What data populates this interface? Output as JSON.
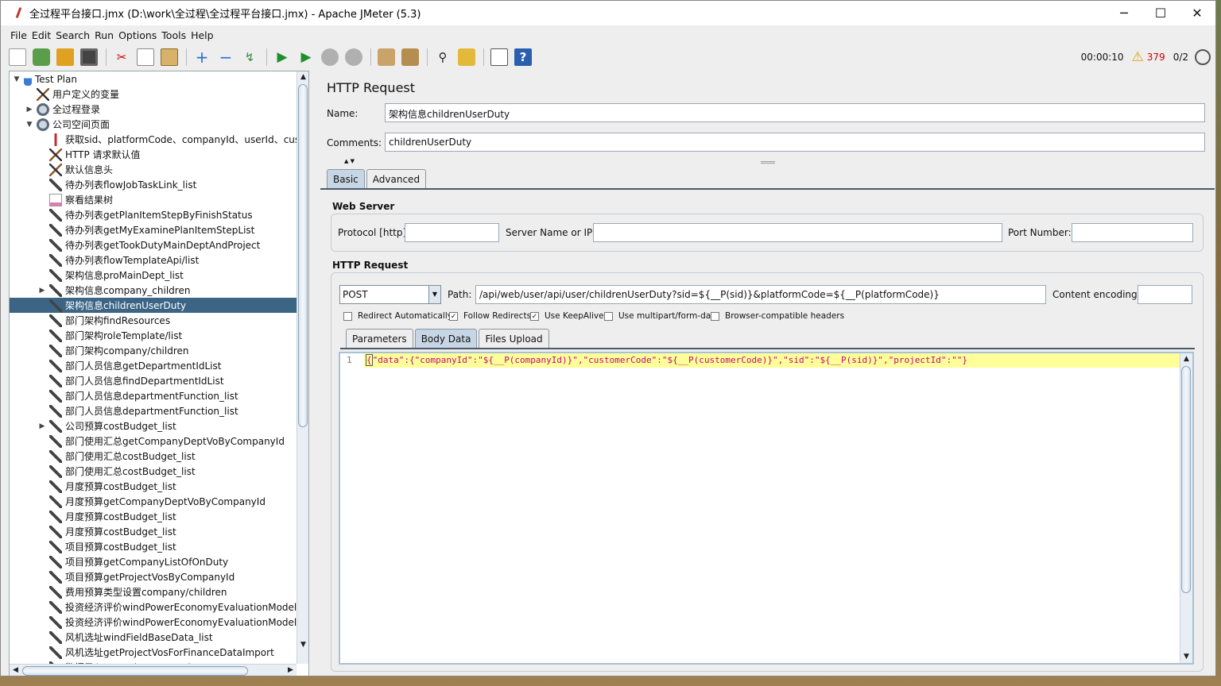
{
  "window": {
    "title": "全过程平台接口.jmx (D:\\work\\全过程\\全过程平台接口.jmx) - Apache JMeter (5.3)",
    "minimize": "─",
    "maximize": "☐",
    "close": "✕"
  },
  "menu": [
    "File",
    "Edit",
    "Search",
    "Run",
    "Options",
    "Tools",
    "Help"
  ],
  "toolbar": {
    "elapsed": "00:00:10",
    "warning_count": "379",
    "threads": "0/2"
  },
  "tree": {
    "items": [
      {
        "label": "Test Plan",
        "icon": "test-plan-icon",
        "level": 0,
        "toggle": "expanded"
      },
      {
        "label": "用户定义的变量",
        "icon": "wrench-icon",
        "level": 1
      },
      {
        "label": "全过程登录",
        "icon": "gear-icon",
        "level": 1,
        "toggle": "collapsed"
      },
      {
        "label": "公司空间页面",
        "icon": "gear-icon",
        "level": 1,
        "toggle": "expanded"
      },
      {
        "label": "获取sid、platformCode、companyId、userId、custo",
        "icon": "redirect-icon",
        "level": 2
      },
      {
        "label": "HTTP 请求默认值",
        "icon": "wrench-icon",
        "level": 2
      },
      {
        "label": "默认信息头",
        "icon": "wrench-icon",
        "level": 2
      },
      {
        "label": "待办列表flowJobTaskLink_list",
        "icon": "pipette-icon",
        "level": 2
      },
      {
        "label": "察看结果树",
        "icon": "graph-icon",
        "level": 2
      },
      {
        "label": "待办列表getPlanItemStepByFinishStatus",
        "icon": "pipette-icon",
        "level": 2
      },
      {
        "label": "待办列表getMyExaminePlanItemStepList",
        "icon": "pipette-icon",
        "level": 2
      },
      {
        "label": "待办列表getTookDutyMainDeptAndProject",
        "icon": "pipette-icon",
        "level": 2
      },
      {
        "label": "待办列表flowTemplateApi/list",
        "icon": "pipette-icon",
        "level": 2
      },
      {
        "label": "架构信息proMainDept_list",
        "icon": "pipette-icon",
        "level": 2
      },
      {
        "label": "架构信息company_children",
        "icon": "pipette-icon",
        "level": 2,
        "toggle": "collapsed"
      },
      {
        "label": "架构信息childrenUserDuty",
        "icon": "pipette-icon",
        "level": 2,
        "selected": true
      },
      {
        "label": "部门架构findResources",
        "icon": "pipette-icon",
        "level": 2
      },
      {
        "label": "部门架构roleTemplate/list",
        "icon": "pipette-icon",
        "level": 2
      },
      {
        "label": "部门架构company/children",
        "icon": "pipette-icon",
        "level": 2
      },
      {
        "label": "部门人员信息getDepartmentIdList",
        "icon": "pipette-icon",
        "level": 2
      },
      {
        "label": "部门人员信息findDepartmentIdList",
        "icon": "pipette-icon",
        "level": 2
      },
      {
        "label": "部门人员信息departmentFunction_list",
        "icon": "pipette-icon",
        "level": 2
      },
      {
        "label": "部门人员信息departmentFunction_list",
        "icon": "pipette-icon",
        "level": 2
      },
      {
        "label": "公司预算costBudget_list",
        "icon": "pipette-icon",
        "level": 2,
        "toggle": "collapsed"
      },
      {
        "label": "部门使用汇总getCompanyDeptVoByCompanyId",
        "icon": "pipette-icon",
        "level": 2
      },
      {
        "label": "部门使用汇总costBudget_list",
        "icon": "pipette-icon",
        "level": 2
      },
      {
        "label": "部门使用汇总costBudget_list",
        "icon": "pipette-icon",
        "level": 2
      },
      {
        "label": "月度预算costBudget_list",
        "icon": "pipette-icon",
        "level": 2
      },
      {
        "label": "月度预算getCompanyDeptVoByCompanyId",
        "icon": "pipette-icon",
        "level": 2
      },
      {
        "label": "月度预算costBudget_list",
        "icon": "pipette-icon",
        "level": 2
      },
      {
        "label": "月度预算costBudget_list",
        "icon": "pipette-icon",
        "level": 2
      },
      {
        "label": "项目预算costBudget_list",
        "icon": "pipette-icon",
        "level": 2
      },
      {
        "label": "项目预算getCompanyListOfOnDuty",
        "icon": "pipette-icon",
        "level": 2
      },
      {
        "label": "项目预算getProjectVosByCompanyId",
        "icon": "pipette-icon",
        "level": 2
      },
      {
        "label": "费用预算类型设置company/children",
        "icon": "pipette-icon",
        "level": 2
      },
      {
        "label": "投资经济评价windPowerEconomyEvaluationModel",
        "icon": "pipette-icon",
        "level": 2
      },
      {
        "label": "投资经济评价windPowerEconomyEvaluationModel_lis",
        "icon": "pipette-icon",
        "level": 2
      },
      {
        "label": "风机选址windFieldBaseData_list",
        "icon": "pipette-icon",
        "level": 2
      },
      {
        "label": "风机选址getProjectVosForFinanceDataImport",
        "icon": "pipette-icon",
        "level": 2
      },
      {
        "label": "数据录入getProjectVosForFinanceDataImport",
        "icon": "pipette-icon",
        "level": 2
      }
    ]
  },
  "panel": {
    "heading": "HTTP Request",
    "name_label": "Name:",
    "name_value": "架构信息childrenUserDuty",
    "comments_label": "Comments:",
    "comments_value": "childrenUserDuty",
    "tabs": [
      "Basic",
      "Advanced"
    ],
    "web_server": {
      "title": "Web Server",
      "protocol_label": "Protocol [http]:",
      "protocol_value": "",
      "server_label": "Server Name or IP:",
      "server_value": "",
      "port_label": "Port Number:",
      "port_value": ""
    },
    "http_request": {
      "title": "HTTP Request",
      "method": "POST",
      "path_label": "Path:",
      "path_value": "/api/web/user/api/user/childrenUserDuty?sid=${__P(sid)}&platformCode=${__P(platformCode)}",
      "encoding_label": "Content encoding:",
      "encoding_value": "",
      "checkboxes": [
        {
          "label": "Redirect Automatically",
          "checked": false
        },
        {
          "label": "Follow Redirects",
          "checked": true
        },
        {
          "label": "Use KeepAlive",
          "checked": true
        },
        {
          "label": "Use multipart/form-data",
          "checked": false
        },
        {
          "label": "Browser-compatible headers",
          "checked": false
        }
      ],
      "subtabs": [
        "Parameters",
        "Body Data",
        "Files Upload"
      ],
      "body_line_number": "1",
      "body_open_brace": "{",
      "body_text": "\"data\":{\"companyId\":\"${__P(companyId)}\",\"customerCode\":\"${__P(customerCode)}\",\"sid\":\"${__P(sid)}\",\"projectId\":\"\"}"
    }
  },
  "colors": {
    "selection": "#3c6585",
    "code_highlight": "#ffff99",
    "code_text": "#c4067e",
    "warning_count": "#d00000"
  }
}
